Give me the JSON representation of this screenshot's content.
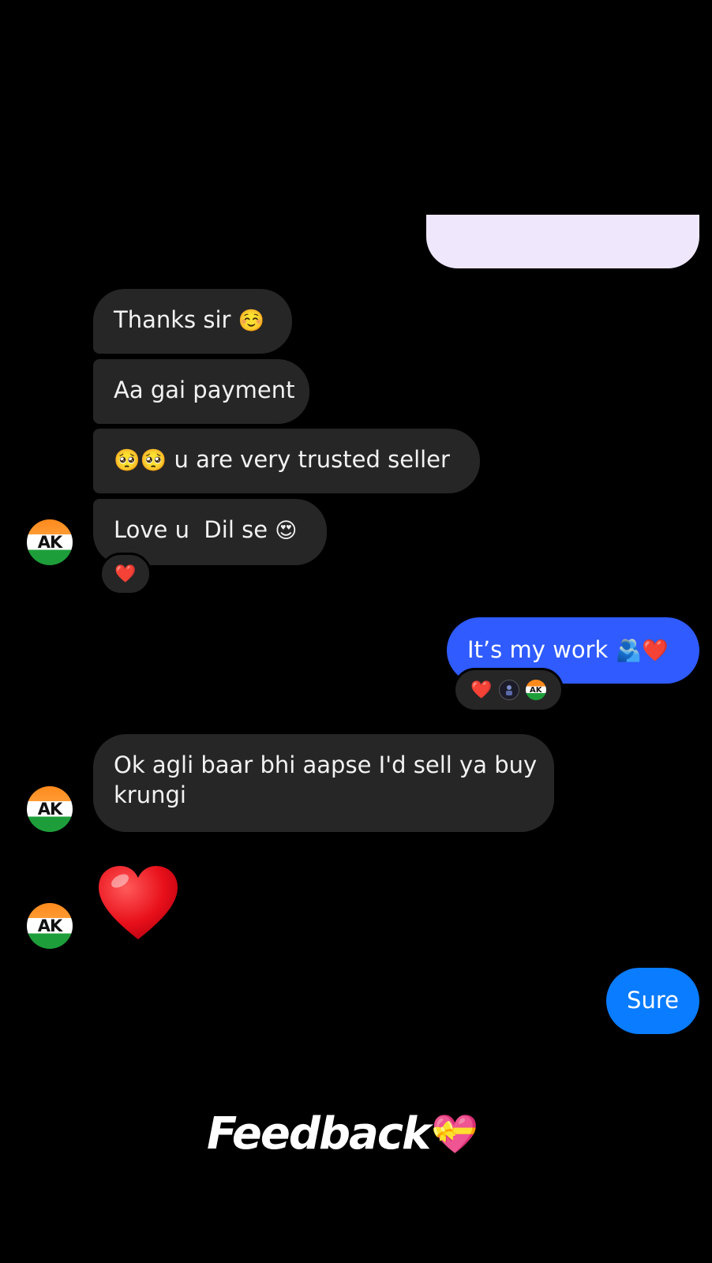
{
  "conversation": {
    "contact_initials": "AK",
    "messages": [
      {
        "from": "contact",
        "text": "Thanks sir",
        "emoji": "☺️"
      },
      {
        "from": "contact",
        "text": "Aa gai payment"
      },
      {
        "from": "contact",
        "lead_emoji": "🥺🥺",
        "text": "u are very trusted seller"
      },
      {
        "from": "contact",
        "text": "Love u  Dil se",
        "emoji": "😍",
        "reaction": "❤️"
      },
      {
        "from": "me",
        "text": "It’s my work",
        "emoji": "🫂❤️",
        "reactions": [
          "❤️",
          "",
          "AK"
        ]
      },
      {
        "from": "contact",
        "text_line1": "Ok agli baar bhi aapse I'd sell ya buy",
        "text_line2": "krungi"
      },
      {
        "from": "contact",
        "big_emoji": "❤️"
      },
      {
        "from": "me",
        "text": "Sure"
      }
    ]
  },
  "caption": {
    "text": "Feedback",
    "emoji": "💝"
  },
  "colors": {
    "background": "#000000",
    "incoming_bubble": "#262626",
    "outgoing_bubble": "#2f5bff",
    "outgoing_bubble_sure": "#0a7cff",
    "top_bubble": "#efe7fb"
  }
}
